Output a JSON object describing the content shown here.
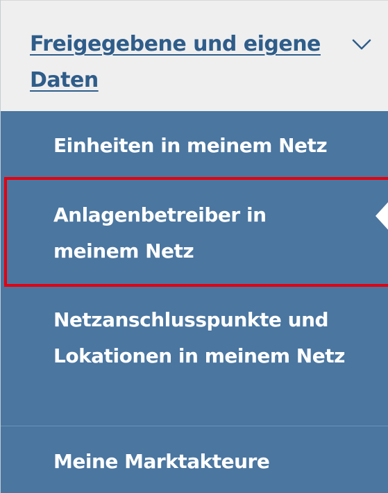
{
  "section": {
    "title": "Freigegebene und eigene Daten",
    "expanded_icon": "chevron-down-icon"
  },
  "nav_items": [
    {
      "label": "Einheiten in meinem Netz",
      "active": false
    },
    {
      "label": "Anlagenbetreiber in meinem Netz",
      "active": true
    },
    {
      "label": "Netzanschlusspunkte und Lokationen in meinem Netz",
      "active": false
    },
    {
      "label": "Meine Marktakteure",
      "active": false
    }
  ],
  "colors": {
    "header_bg": "#efefef",
    "header_link": "#2f5d8a",
    "nav_bg": "#4a76a0",
    "active_outline": "#e3000f",
    "text": "#ffffff"
  }
}
